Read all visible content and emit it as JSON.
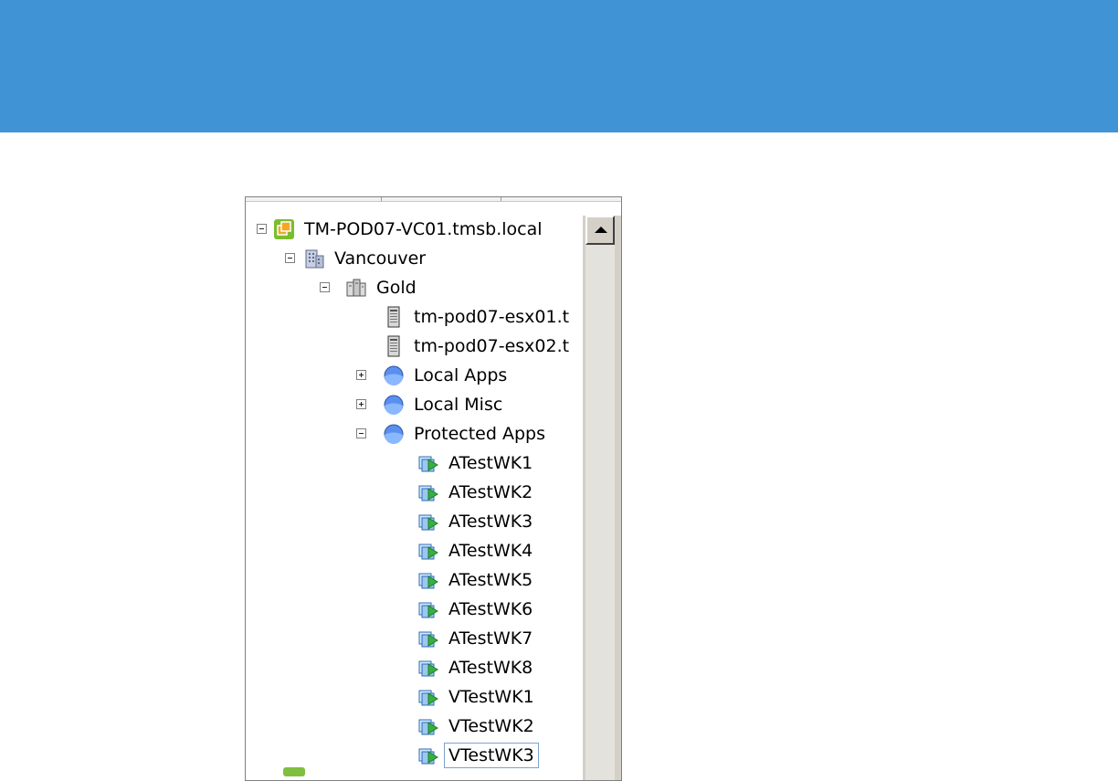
{
  "tree": {
    "root": {
      "label": "TM-POD07-VC01.tmsb.local",
      "icon": "vcenter-icon",
      "expanded": true
    },
    "datacenter": {
      "label": "Vancouver",
      "icon": "datacenter-icon",
      "expanded": true
    },
    "cluster": {
      "label": "Gold",
      "icon": "cluster-icon",
      "expanded": true
    },
    "hosts": [
      {
        "label": "tm-pod07-esx01.t",
        "icon": "host-icon"
      },
      {
        "label": "tm-pod07-esx02.t",
        "icon": "host-icon"
      }
    ],
    "pools": [
      {
        "label": "Local Apps",
        "icon": "resource-pool-icon",
        "expanded": false
      },
      {
        "label": "Local Misc",
        "icon": "resource-pool-icon",
        "expanded": false
      },
      {
        "label": "Protected Apps",
        "icon": "resource-pool-icon",
        "expanded": true
      }
    ],
    "vms": [
      {
        "label": "ATestWK1",
        "icon": "vm-icon"
      },
      {
        "label": "ATestWK2",
        "icon": "vm-icon"
      },
      {
        "label": "ATestWK3",
        "icon": "vm-icon"
      },
      {
        "label": "ATestWK4",
        "icon": "vm-icon"
      },
      {
        "label": "ATestWK5",
        "icon": "vm-icon"
      },
      {
        "label": "ATestWK6",
        "icon": "vm-icon"
      },
      {
        "label": "ATestWK7",
        "icon": "vm-icon"
      },
      {
        "label": "ATestWK8",
        "icon": "vm-icon"
      },
      {
        "label": "VTestWK1",
        "icon": "vm-icon"
      },
      {
        "label": "VTestWK2",
        "icon": "vm-icon"
      },
      {
        "label": "VTestWK3",
        "icon": "vm-icon",
        "selected": true
      }
    ]
  },
  "colors": {
    "banner": "#4094d6",
    "vm_green": "#3aa640",
    "vcenter_orange": "#f0a020",
    "pool_blue": "#3f7fd8"
  }
}
